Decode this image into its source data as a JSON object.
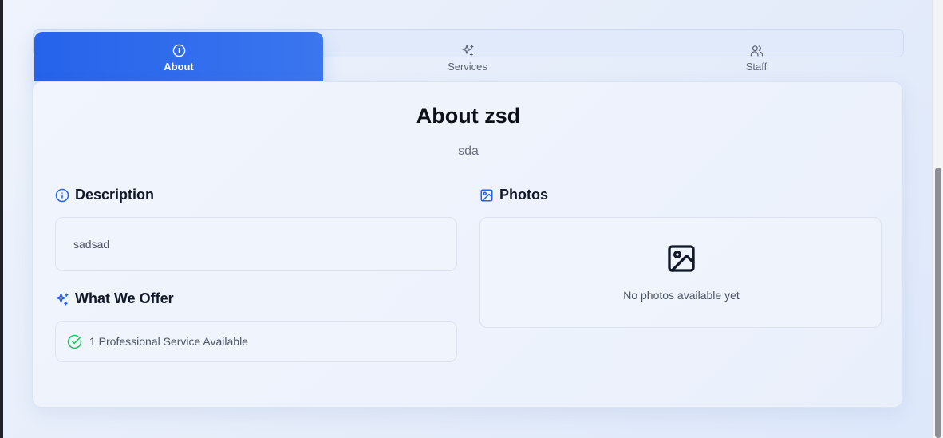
{
  "tabs": [
    {
      "label": "About",
      "icon": "info-icon",
      "active": true
    },
    {
      "label": "Services",
      "icon": "sparkles-icon",
      "active": false
    },
    {
      "label": "Staff",
      "icon": "users-icon",
      "active": false
    }
  ],
  "about": {
    "title": "About zsd",
    "subtitle": "sda"
  },
  "description": {
    "heading": "Description",
    "icon": "info-icon",
    "text": "sadsad"
  },
  "offer": {
    "heading": "What We Offer",
    "icon": "sparkles-icon",
    "item": "1 Professional Service Available",
    "item_icon": "check-circle-icon"
  },
  "photos": {
    "heading": "Photos",
    "icon": "image-icon",
    "empty_text": "No photos available yet"
  },
  "colors": {
    "accent": "#2563eb",
    "success": "#22c55e",
    "text_dark": "#111827",
    "text_muted": "#6b7280"
  }
}
